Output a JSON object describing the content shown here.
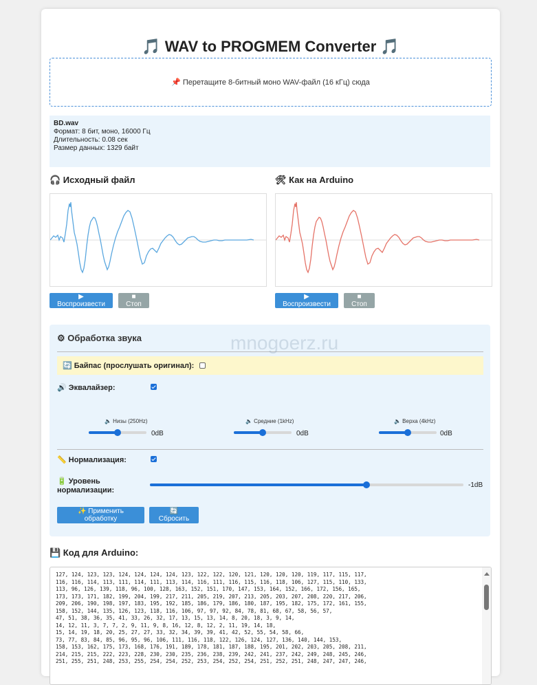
{
  "header": {
    "title": "🎵 WAV to PROGMEM Converter 🎵"
  },
  "dropzone": {
    "text": "📌 Перетащите 8-битный моно WAV-файл (16 кГц) сюда"
  },
  "file_info": {
    "name": "BD.wav",
    "format": "Формат: 8 бит, моно, 16000 Гц",
    "duration": "Длительность: 0.08 сек",
    "size": "Размер данных: 1329 байт"
  },
  "original": {
    "title": "🎧 Исходный файл",
    "play_label": "▶ Воспроизвести",
    "stop_label": "■ Стоп",
    "color": "#5aa7df"
  },
  "arduino_preview": {
    "title": "🛠 Как на Arduino",
    "play_label": "▶ Воспроизвести",
    "stop_label": "■ Стоп",
    "color": "#e57368"
  },
  "watermark": "mnogoerz.ru",
  "processing": {
    "title": "⚙ Обработка звука",
    "bypass_label": "🔄 Байпас (прослушать оригинал):",
    "bypass_checked": false,
    "eq_label": "🔊 Эквалайзер:",
    "eq_checked": true,
    "bands": [
      {
        "label": "🔈 Низы (250Hz)",
        "value_text": "0dB",
        "level": 0.5
      },
      {
        "label": "🔈 Средние (1kHz)",
        "value_text": "0dB",
        "level": 0.5
      },
      {
        "label": "🔈 Верха (4kHz)",
        "value_text": "0dB",
        "level": 0.5
      }
    ],
    "norm_label": "📏 Нормализация:",
    "norm_checked": true,
    "norm_level_label_1": "🔋 Уровень",
    "norm_level_label_2": "нормализации:",
    "norm_level_value": "-1dB",
    "norm_level": 0.69,
    "apply_label": "✨ Применить обработку",
    "reset_label": "🔄 Сбросить"
  },
  "code": {
    "title": "💾 Код для Arduino:",
    "lines": [
      "127, 124, 123, 123, 124, 124, 124, 124, 123, 122, 122, 120, 121, 120, 120, 120, 119, 117, 115, 117,",
      "116, 116, 114, 113, 111, 114, 111, 113, 114, 116, 111, 116, 115, 116, 118, 106, 127, 115, 110, 133,",
      "113, 96, 126, 139, 118, 96, 100, 128, 163, 152, 151, 170, 147, 153, 164, 152, 166, 172, 156, 165,",
      "173, 173, 171, 182, 199, 204, 199, 217, 211, 205, 219, 207, 213, 205, 203, 207, 208, 220, 217, 206,",
      "209, 206, 190, 198, 197, 183, 195, 192, 185, 186, 179, 186, 180, 187, 195, 182, 175, 172, 161, 155,",
      "158, 152, 144, 135, 126, 123, 118, 116, 106, 97, 97, 92, 84, 78, 81, 68, 67, 58, 56, 57,",
      "47, 51, 38, 36, 35, 41, 33, 26, 32, 17, 13, 15, 13, 14, 8, 20, 18, 3, 9, 14,",
      "14, 12, 11, 3, 7, 7, 2, 9, 11, 9, 8, 16, 12, 8, 12, 2, 11, 19, 14, 18,",
      "15, 14, 19, 18, 20, 25, 27, 27, 33, 32, 34, 39, 39, 41, 42, 52, 55, 54, 58, 66,",
      "73, 77, 83, 84, 85, 96, 95, 96, 106, 111, 116, 118, 122, 126, 124, 127, 136, 140, 144, 153,",
      "158, 153, 162, 175, 173, 168, 176, 191, 189, 178, 181, 187, 188, 195, 201, 202, 203, 205, 208, 211,",
      "214, 215, 215, 222, 223, 228, 230, 230, 235, 236, 238, 239, 242, 241, 237, 242, 249, 248, 245, 246,",
      "251, 255, 251, 248, 253, 255, 254, 254, 252, 253, 254, 252, 254, 251, 252, 251, 248, 247, 247, 246,"
    ]
  }
}
